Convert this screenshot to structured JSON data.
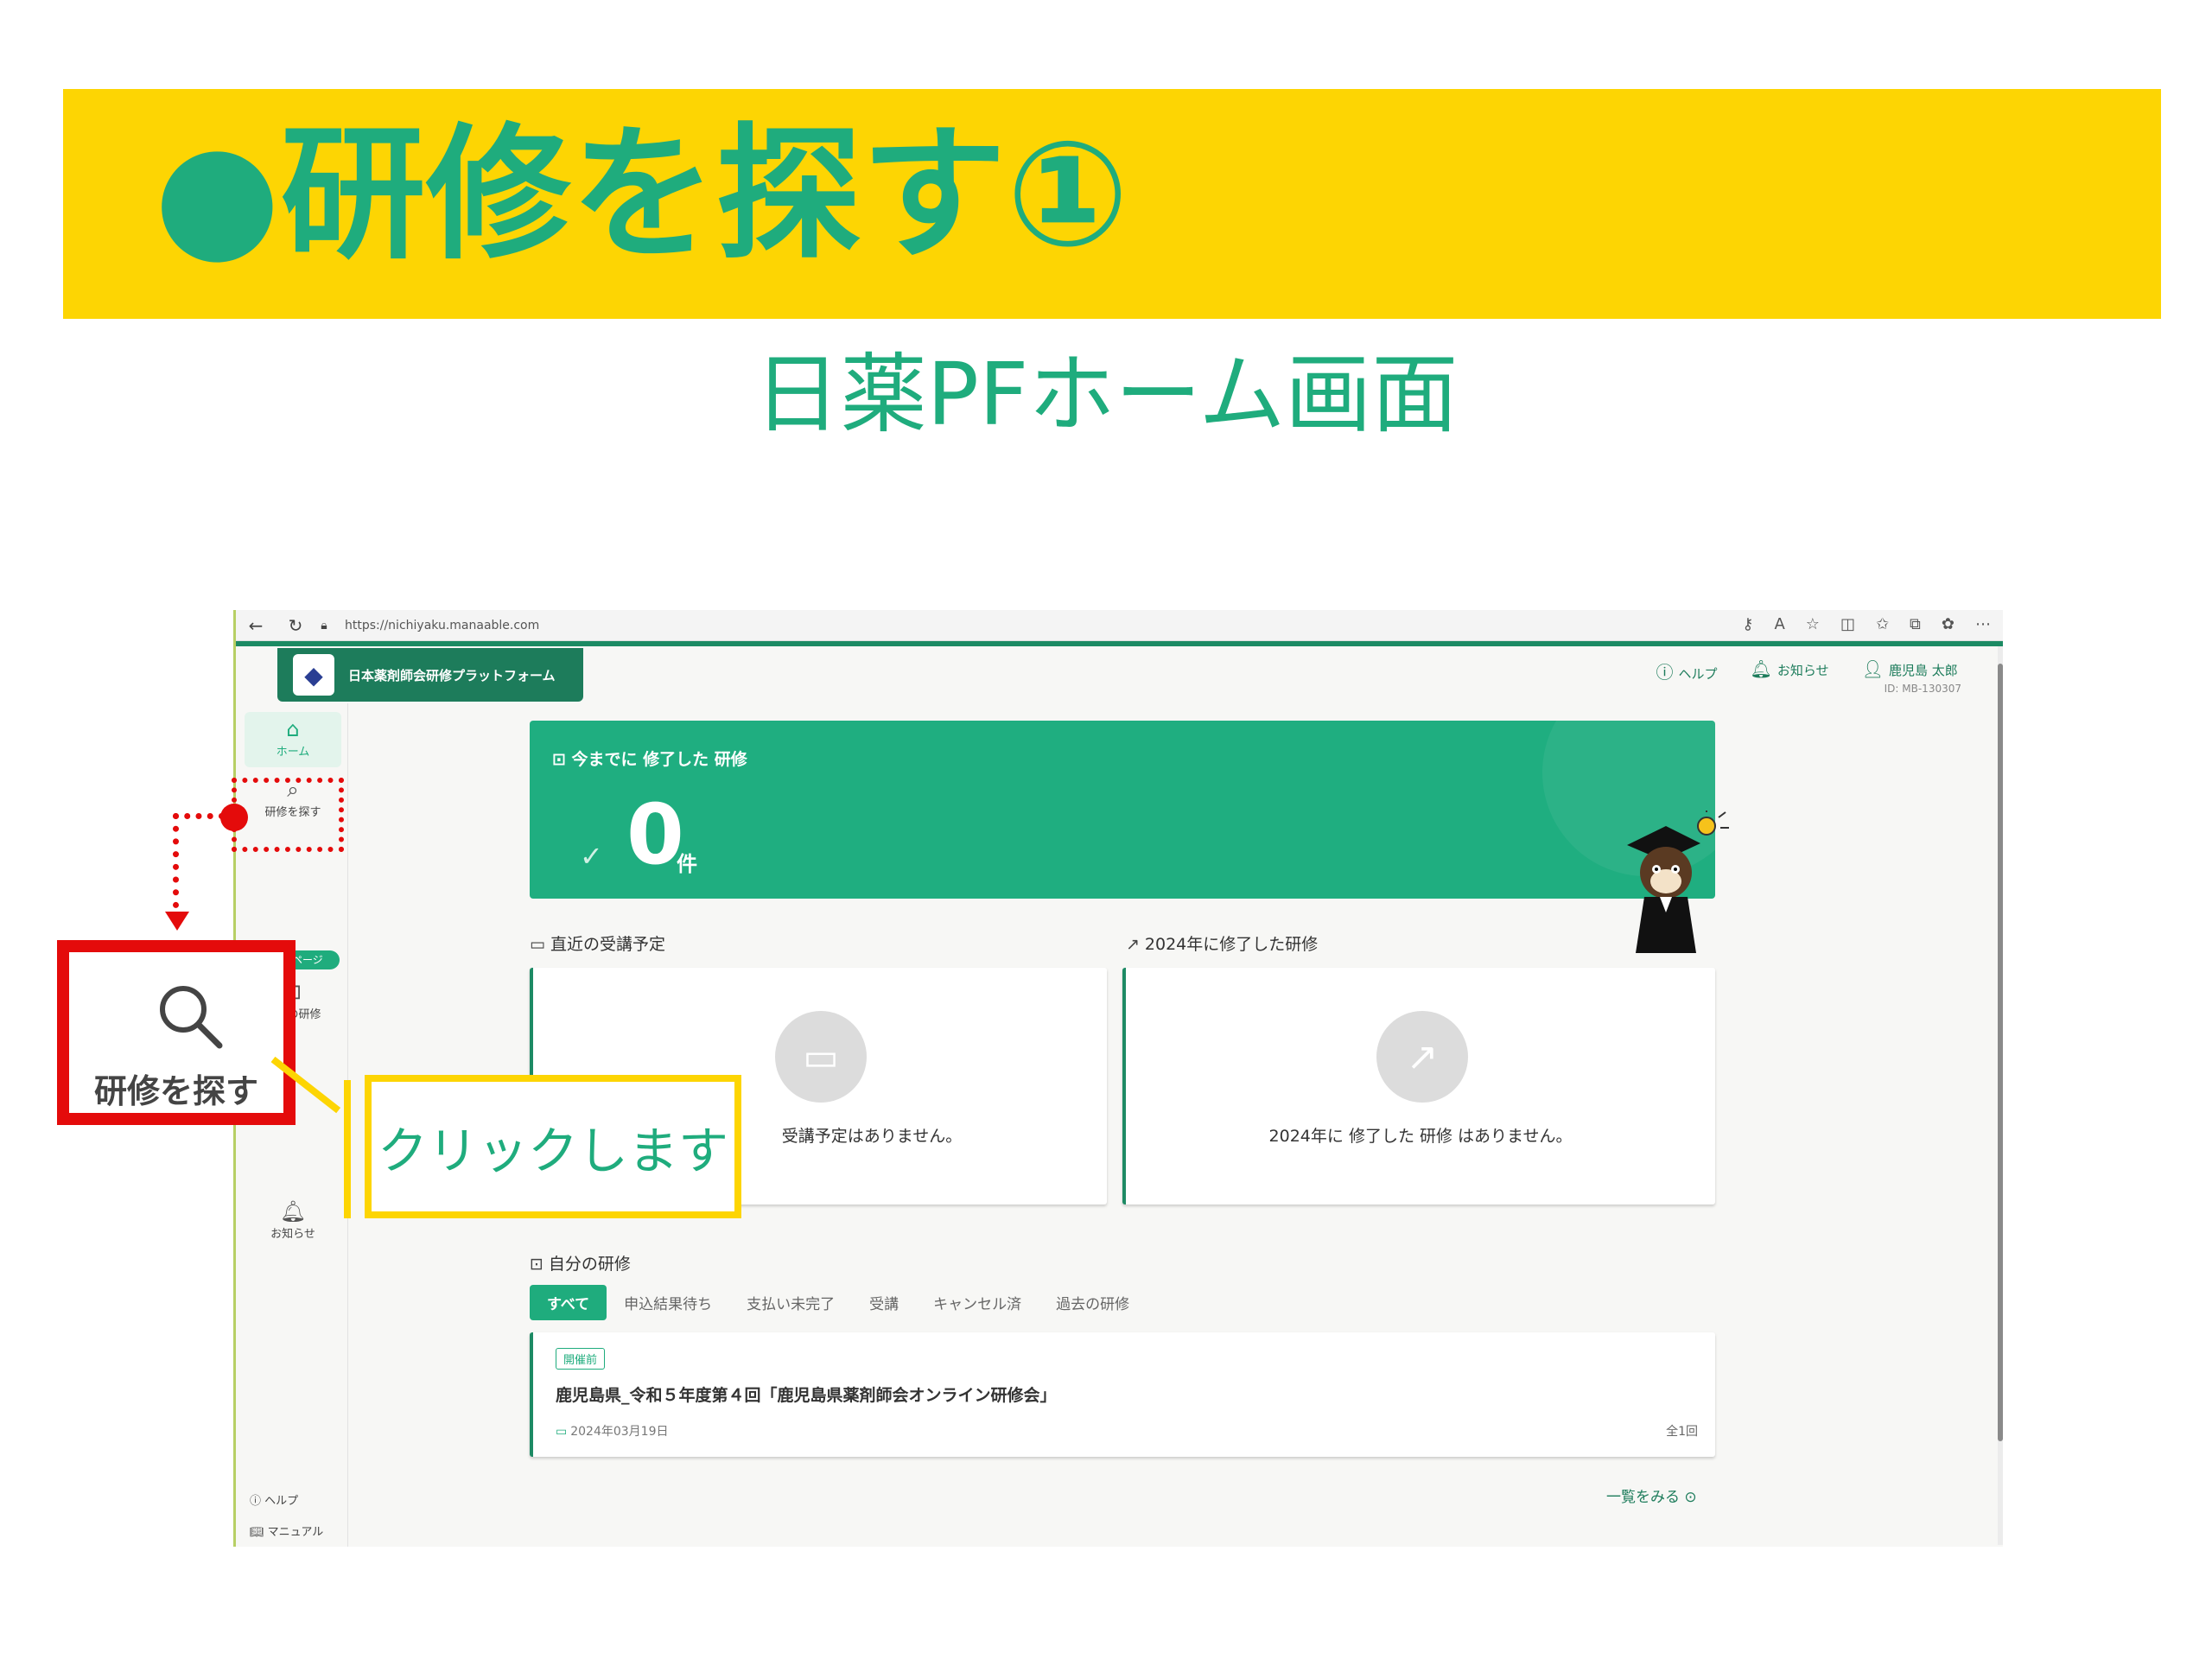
{
  "slide": {
    "title": "●研修を探す①",
    "subtitle": "日薬PFホーム画面"
  },
  "browser": {
    "url": "https://nichiyaku.manaable.com",
    "back_icon": "back-arrow-icon",
    "reload_icon": "reload-icon"
  },
  "app": {
    "logo_text": "日本薬剤師会研修プラットフォーム",
    "header": {
      "help": "ヘルプ",
      "notifications": "お知らせ",
      "user_name": "鹿児島 太郎",
      "user_id": "ID: MB-130307"
    },
    "sidebar": {
      "home": "ホーム",
      "search": "研修を探す",
      "mypage": "マイページ",
      "my_trainings": "自分の研修",
      "notifications": "お知らせ",
      "help": "ヘルプ",
      "manual": "マニュアル"
    },
    "hero": {
      "title": "今までに 修了した 研修",
      "count": "0",
      "unit": "件"
    },
    "upcoming": {
      "label": "直近の受講予定",
      "empty": "受講予定はありません。"
    },
    "completed": {
      "label": "2024年に修了した研修",
      "empty": "2024年に 修了した 研修 はありません。"
    },
    "my_trainings": {
      "label": "自分の研修",
      "tabs": [
        "すべて",
        "申込結果待ち",
        "支払い未完了",
        "受講",
        "キャンセル済",
        "過去の研修"
      ],
      "course": {
        "badge": "開催前",
        "title": "鹿児島県_令和５年度第４回「鹿児島県薬剤師会オンライン研修会」",
        "date": "2024年03月19日",
        "count": "全1回"
      },
      "see_all": "一覧をみる"
    }
  },
  "annotation": {
    "zoom_label": "研修を探す",
    "click_label": "クリックします"
  },
  "colors": {
    "banner": "#fdd503",
    "accent": "#1fac7d",
    "annotation_red": "#e40b0b"
  }
}
